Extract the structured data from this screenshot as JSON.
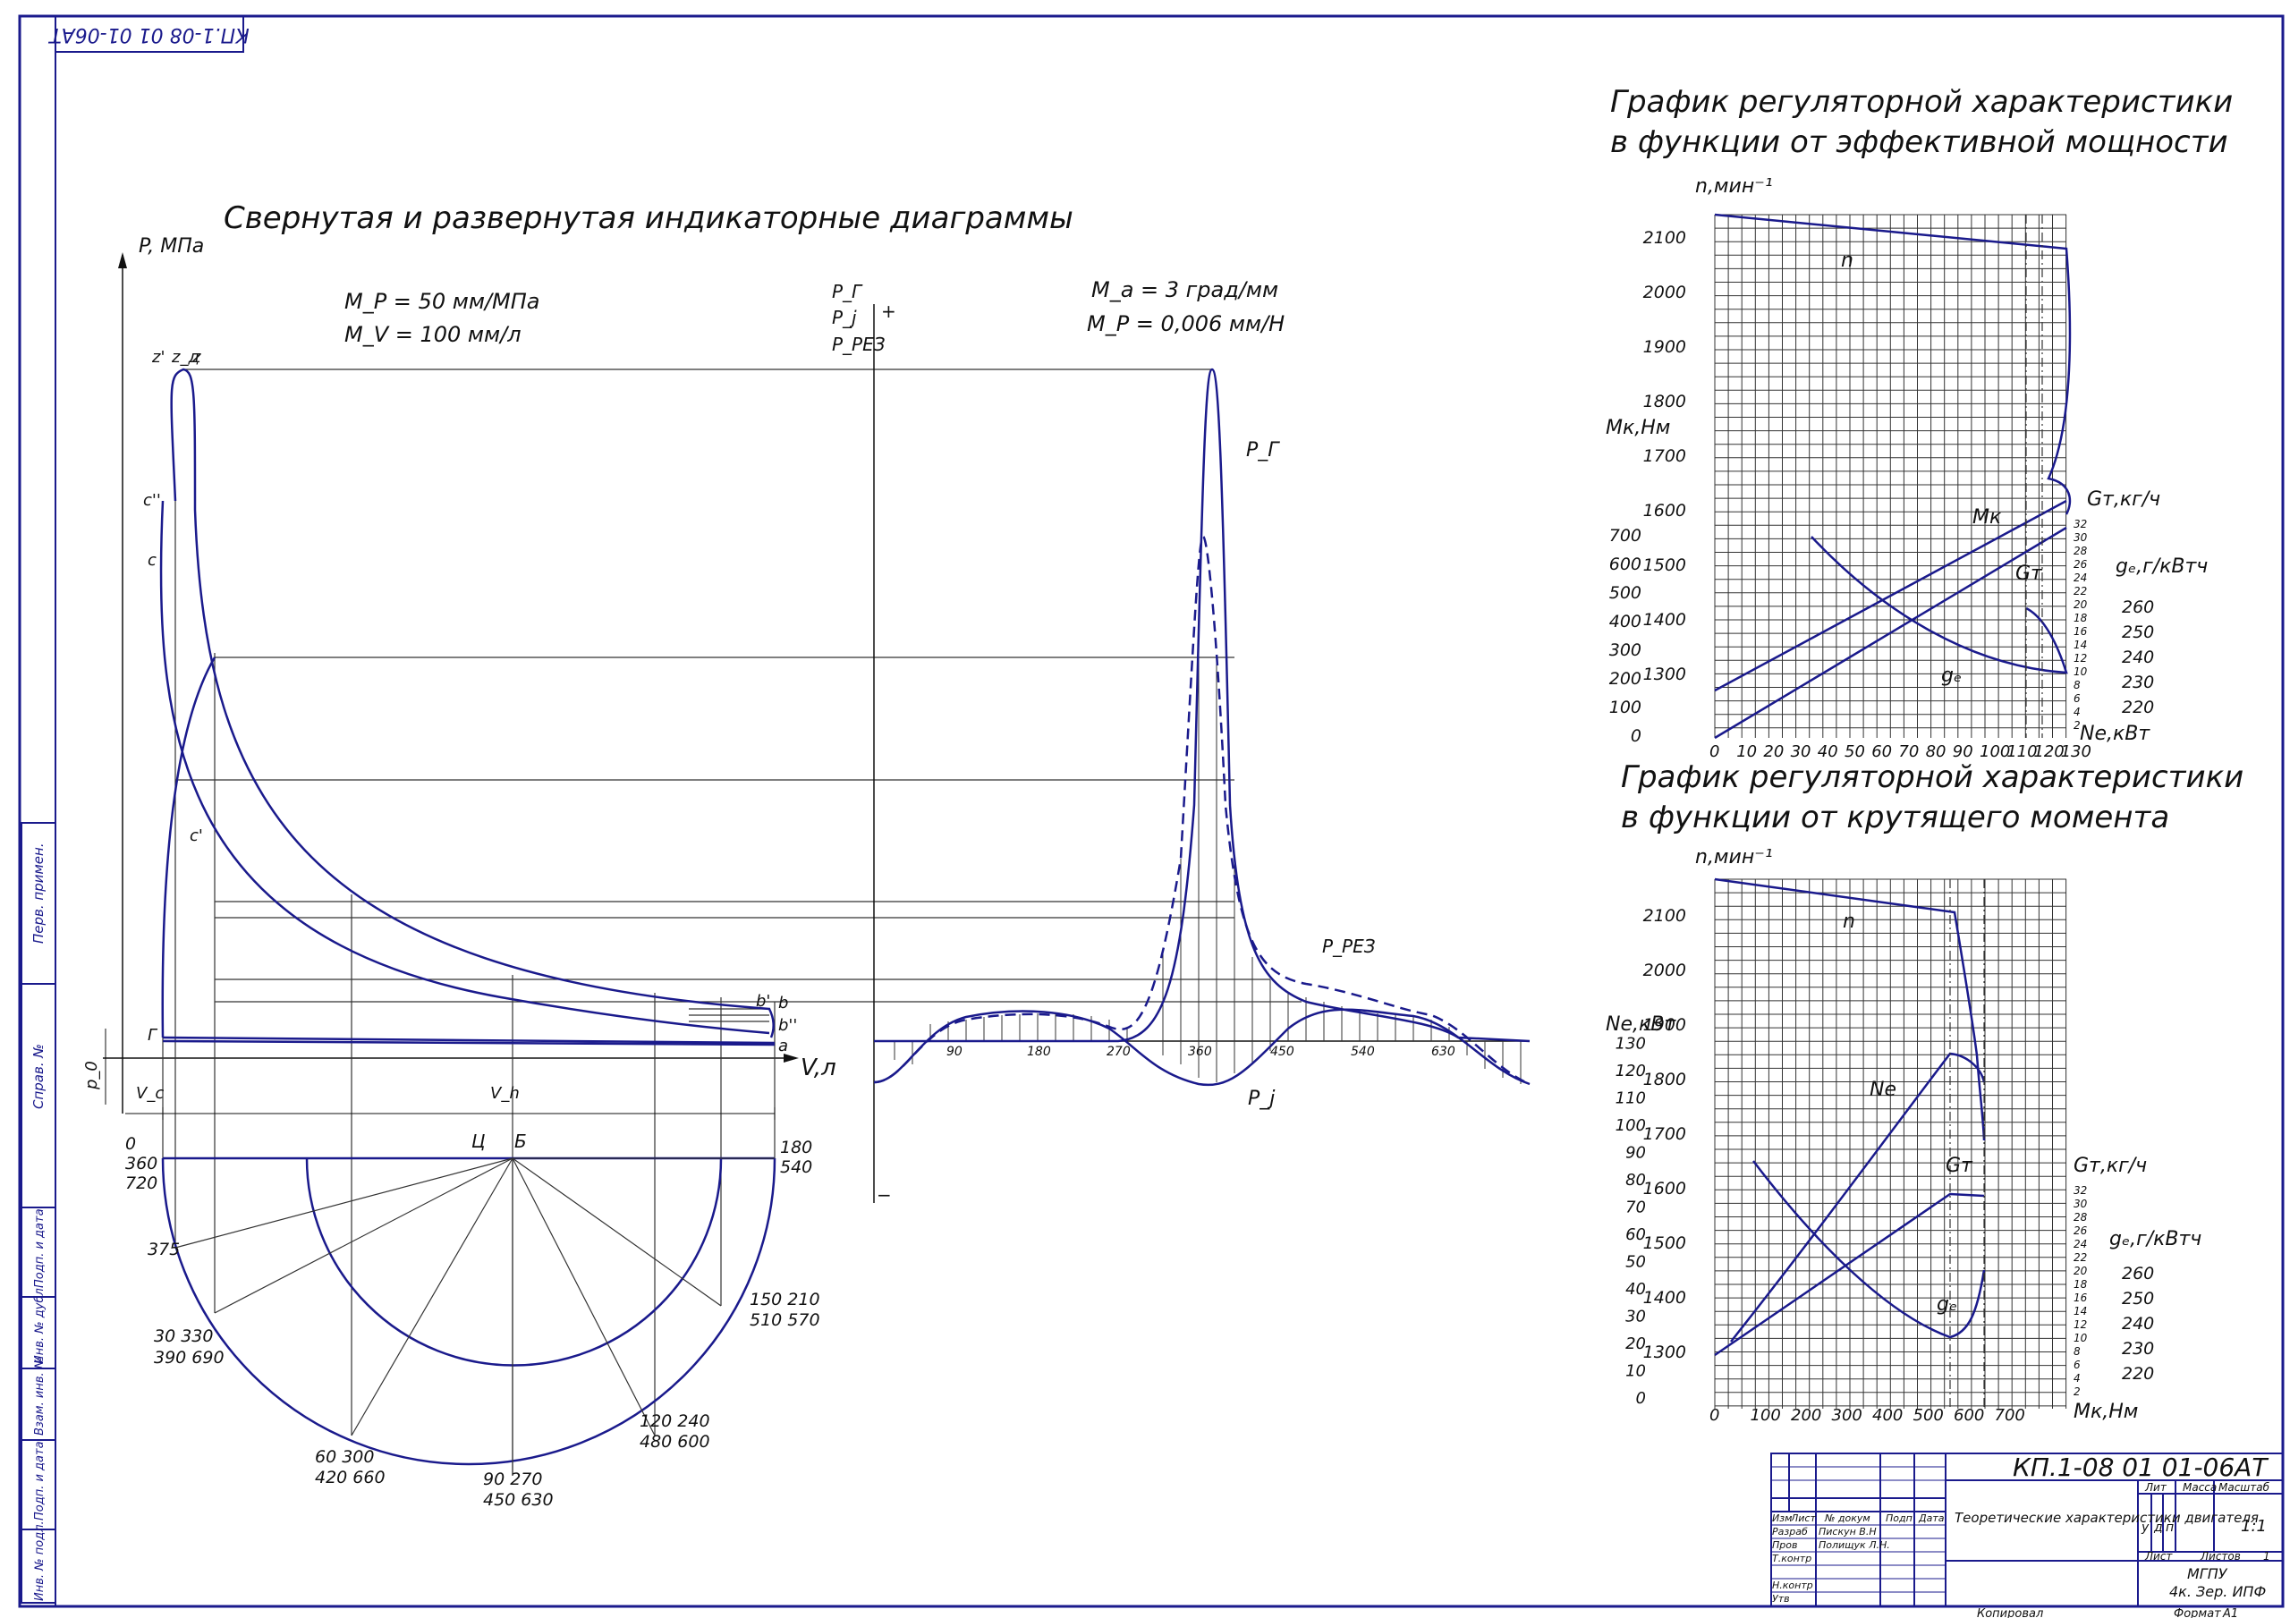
{
  "stamp_number": "КП.1-08 01 01-06АТ",
  "indicator": {
    "title": "Свернутая и развернутая индикаторные диаграммы",
    "scale_p": "M_P = 50 мм/МПа",
    "scale_v": "M_V = 100 мм/л",
    "scale_a": "M_a = 3 град/мм",
    "scale_p2": "M_P = 0,006 мм/Н",
    "p_axis": "P, МПа",
    "v_axis": "V,л",
    "pr_axis_1": "P_Г",
    "pr_axis_2": "P_j",
    "pr_axis_3": "P_РЕЗ",
    "pts": {
      "z1": "z'",
      "z2": "z_д",
      "z3": "z",
      "c2": "c''",
      "c": "c",
      "c1": "c'",
      "g": "Г",
      "b1": "b'",
      "b": "b",
      "b2": "b''",
      "a": "a",
      "p0": "p_0",
      "vc": "V_c",
      "vh": "V_h",
      "plus": "+",
      "minus": "−",
      "pg": "P_Г",
      "pj": "P_j",
      "prez": "P_РЕЗ"
    },
    "angle_ticks": [
      "90",
      "180",
      "270",
      "360",
      "450",
      "540",
      "630"
    ],
    "crank": {
      "c_label": "Ц",
      "b_label": "Б",
      "l0": "0",
      "l360": "360",
      "l720": "720",
      "l180": "180",
      "l540": "540",
      "l375": "375",
      "l30": "30 330",
      "l390": "390 690",
      "l150": "150 210",
      "l510": "510 570",
      "l60": "60 300",
      "l420": "420 660",
      "l90": "90 270",
      "l450": "450 630",
      "l120": "120 240",
      "l480": "480 600"
    }
  },
  "chart_top": {
    "title_1": "График регуляторной характеристики",
    "title_2": "в функции от эффективной мощности",
    "n_axis": "n,мин⁻¹",
    "mk_axis": "Mк,Нм",
    "gm_axis": "Gт,кг/ч",
    "ge_axis": "gₑ,г/кВтч",
    "x_axis": "Ne,кВт",
    "n_ticks": [
      "1300",
      "1400",
      "1500",
      "1600",
      "1700",
      "1800",
      "1900",
      "2000",
      "2100"
    ],
    "mk_ticks": [
      "0",
      "100",
      "200",
      "300",
      "400",
      "500",
      "600",
      "700"
    ],
    "x_ticks": [
      "0",
      "10",
      "20",
      "30",
      "40",
      "50",
      "60",
      "70",
      "80",
      "90",
      "100",
      "110",
      "120",
      "130"
    ],
    "gm_ticks": [
      "2",
      "4",
      "6",
      "8",
      "10",
      "12",
      "14",
      "16",
      "18",
      "20",
      "22",
      "24",
      "26",
      "28",
      "30",
      "32"
    ],
    "ge_ticks": [
      "220",
      "230",
      "240",
      "250",
      "260"
    ],
    "curve_labels": {
      "n": "n",
      "mk": "Mк",
      "gm": "Gт",
      "ge": "gₑ"
    }
  },
  "chart_bottom": {
    "title_1": "График регуляторной характеристики",
    "title_2": "в функции от крутящего момента",
    "n_axis": "n,мин⁻¹",
    "ne_axis": "Ne,кВт",
    "gm_axis": "Gт,кг/ч",
    "ge_axis": "gₑ,г/кВтч",
    "x_axis": "Mк,Нм",
    "n_ticks": [
      "1300",
      "1400",
      "1500",
      "1600",
      "1700",
      "1800",
      "1900",
      "2000",
      "2100"
    ],
    "ne_ticks": [
      "0",
      "10",
      "20",
      "30",
      "40",
      "50",
      "60",
      "70",
      "80",
      "90",
      "100",
      "110",
      "120",
      "130"
    ],
    "x_ticks": [
      "0",
      "100",
      "200",
      "300",
      "400",
      "500",
      "600",
      "700"
    ],
    "gm_ticks": [
      "2",
      "4",
      "6",
      "8",
      "10",
      "12",
      "14",
      "16",
      "18",
      "20",
      "22",
      "24",
      "26",
      "28",
      "30",
      "32"
    ],
    "ge_ticks": [
      "220",
      "230",
      "240",
      "250",
      "260"
    ],
    "curve_labels": {
      "n": "n",
      "ne": "Ne",
      "gm": "Gт",
      "ge": "gₑ"
    }
  },
  "title_block": {
    "code": "КП.1-08 01 01-06АТ",
    "doc_title": "Теоретические характеристики двигателя",
    "col_izm": "Изм",
    "col_list": "Лист",
    "col_ndoc": "№ докум",
    "col_podp": "Подп",
    "col_data": "Дата",
    "razrab": "Разраб",
    "razrab_name": "Пискун В.Н",
    "prov": "Пров",
    "prov_name": "Полищук Л.Н.",
    "tkontr": "Т.контр",
    "nkontr": "Н.контр",
    "utv": "Утв",
    "lit": "Лит",
    "massa": "Масса",
    "masshtab": "Масштаб",
    "lit_u": "у",
    "lit_d": "д",
    "lit_p": "п",
    "scale_val": "1:1",
    "list": "Лист",
    "listov": "Листов",
    "listov_val": "1",
    "org_1": "МГПУ",
    "org_2": "4к. Зер. ИПФ",
    "kopiroval": "Копировал",
    "format": "Формат",
    "format_val": "А1"
  },
  "side_stamp": {
    "perv_primen": "Перв. примен.",
    "sprav": "Справ. №",
    "podp_data_1": "Подп. и дата",
    "inv_dubl": "Инв. № дубл.",
    "vzam_inv": "Взам. инв. №",
    "podp_data_2": "Подп. и дата",
    "inv_podl": "Инв. № подл."
  },
  "colors": {
    "ink": "#1a1a8c",
    "line": "#111111",
    "thin": "#333333"
  }
}
